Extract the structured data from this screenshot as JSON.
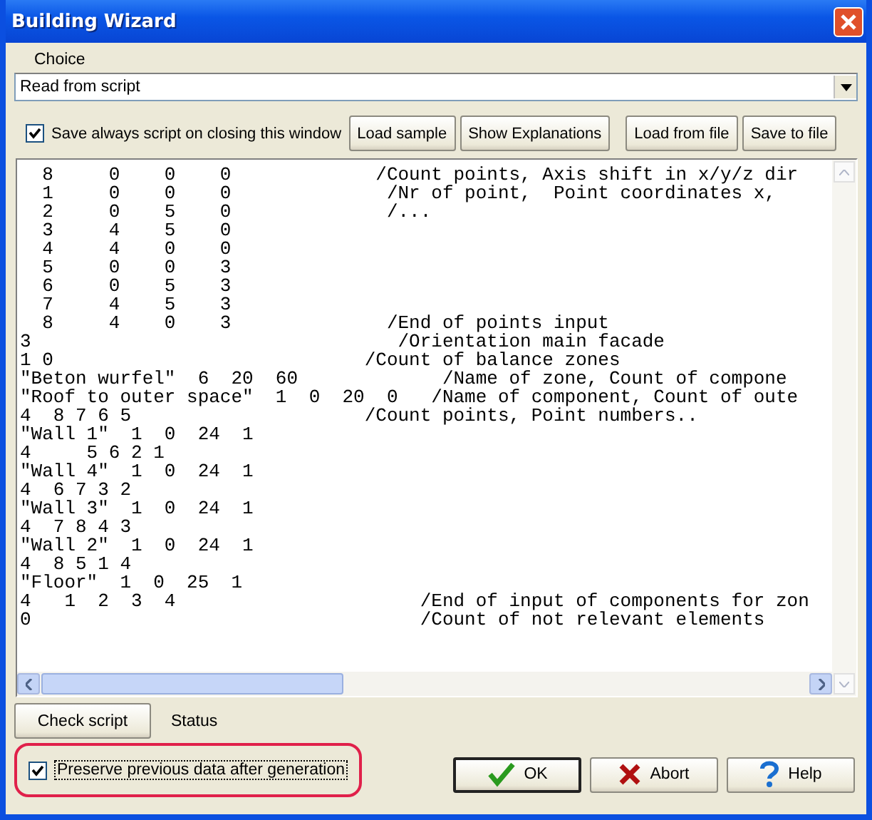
{
  "window": {
    "title": "Building Wizard"
  },
  "choice": {
    "label": "Choice",
    "value": "Read from script"
  },
  "save_always": {
    "label": "Save always script on closing this window",
    "checked": true
  },
  "toolbar_buttons": [
    "Load sample",
    "Show Explanations",
    "Load from file",
    "Save to file"
  ],
  "script_lines": [
    "  8     0    0    0             /Count points, Axis shift in x/y/z dir",
    "  1     0    0    0              /Nr of point,  Point coordinates x,",
    "  2     0    5    0              /...",
    "  3     4    5    0",
    "  4     4    0    0",
    "  5     0    0    3",
    "  6     0    5    3",
    "  7     4    5    3",
    "  8     4    0    3              /End of points input",
    "3                                 /Orientation main facade",
    "1 0                            /Count of balance zones",
    "\"Beton wurfel\"  6  20  60             /Name of zone, Count of compone",
    "\"Roof to outer space\"  1  0  20  0   /Name of component, Count of oute",
    "4  8 7 6 5                     /Count points, Point numbers..",
    "\"Wall 1\"  1  0  24  1",
    "4     5 6 2 1",
    "\"Wall 4\"  1  0  24  1",
    "4  6 7 3 2",
    "\"Wall 3\"  1  0  24  1",
    "4  7 8 4 3",
    "\"Wall 2\"  1  0  24  1",
    "4  8 5 1 4",
    "\"Floor\"  1  0  25  1",
    "4   1  2  3  4                      /End of input of components for zon",
    "0                                   /Count of not relevant elements"
  ],
  "check_button": "Check script",
  "status": "Status",
  "preserve": {
    "label": "Preserve previous data after generation",
    "checked": true,
    "highlighted": true
  },
  "dialog_buttons": [
    {
      "kind": "ok",
      "label": "OK"
    },
    {
      "kind": "abort",
      "label": "Abort"
    },
    {
      "kind": "help",
      "label": "Help"
    }
  ]
}
